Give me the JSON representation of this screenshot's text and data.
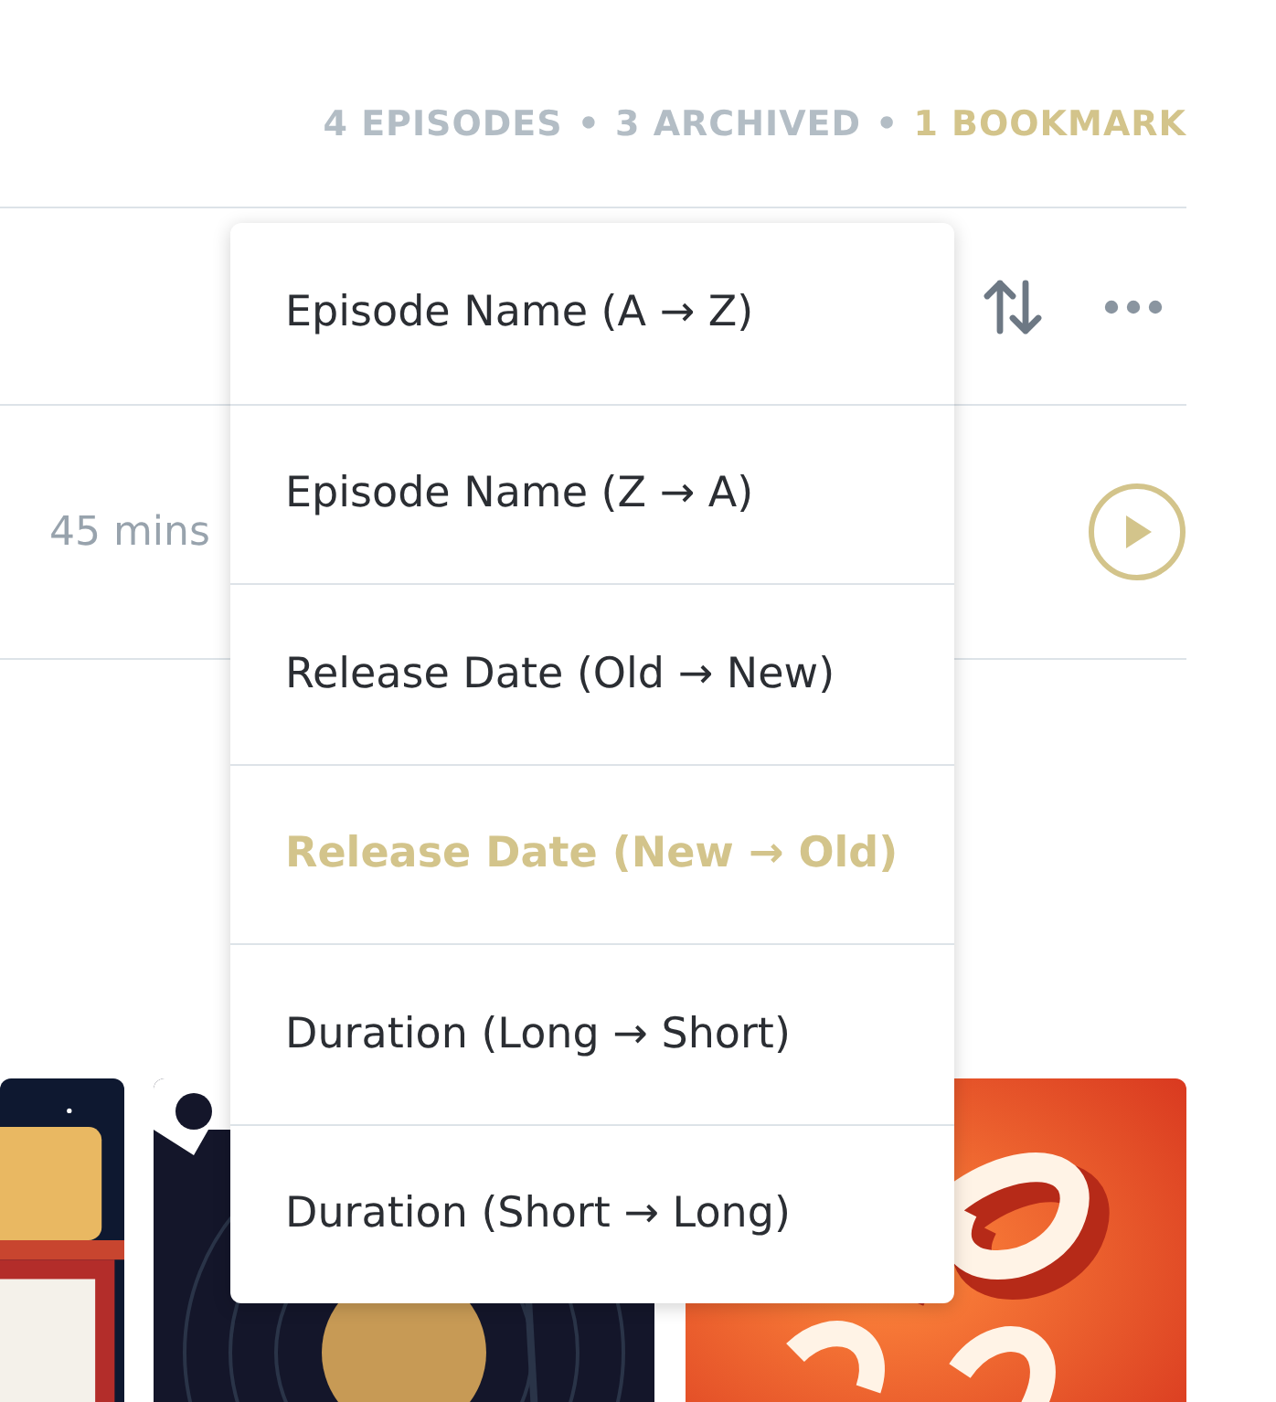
{
  "stats": [
    {
      "text": "4 EPISODES",
      "highlighted": false
    },
    {
      "text": "3 ARCHIVED",
      "highlighted": false
    },
    {
      "text": "1 BOOKMARK",
      "highlighted": true
    }
  ],
  "stat_separators": [
    "•",
    "•"
  ],
  "episode": {
    "duration": "45 mins"
  },
  "sort_menu": {
    "options": [
      {
        "label": "Episode Name (A → Z)",
        "selected": false
      },
      {
        "label": "Episode Name (Z → A)",
        "selected": false
      },
      {
        "label": "Release Date (Old → New)",
        "selected": false
      },
      {
        "label": "Release Date (New → Old)",
        "selected": true
      },
      {
        "label": "Duration (Long → Short)",
        "selected": false
      },
      {
        "label": "Duration (Short → Long)",
        "selected": false
      }
    ]
  },
  "podcasts": [
    {
      "kind": "picture"
    },
    {
      "kind": "picture"
    },
    {
      "kind": "picture"
    }
  ]
}
